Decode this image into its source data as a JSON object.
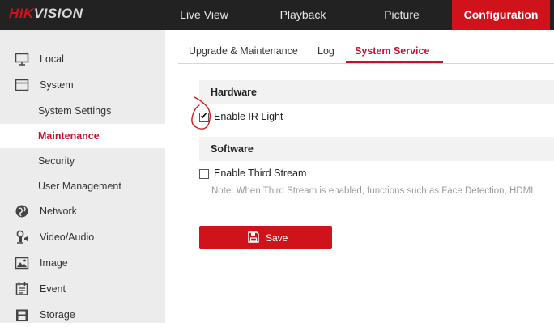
{
  "brand": {
    "logo_prefix": "HIK",
    "logo_suffix": "VISION"
  },
  "topnav": {
    "items": [
      {
        "label": "Live View"
      },
      {
        "label": "Playback"
      },
      {
        "label": "Picture"
      },
      {
        "label": "Configuration",
        "active": true
      }
    ]
  },
  "sidebar": {
    "items": [
      {
        "label": "Local",
        "icon": "monitor-icon"
      },
      {
        "label": "System",
        "icon": "system-icon"
      },
      {
        "label": "System Settings",
        "sub": true
      },
      {
        "label": "Maintenance",
        "sub": true,
        "active": true
      },
      {
        "label": "Security",
        "sub": true
      },
      {
        "label": "User Management",
        "sub": true
      },
      {
        "label": "Network",
        "icon": "globe-icon"
      },
      {
        "label": "Video/Audio",
        "icon": "video-audio-icon"
      },
      {
        "label": "Image",
        "icon": "image-icon"
      },
      {
        "label": "Event",
        "icon": "event-icon"
      },
      {
        "label": "Storage",
        "icon": "storage-icon"
      }
    ]
  },
  "tabs": {
    "items": [
      {
        "label": "Upgrade & Maintenance"
      },
      {
        "label": "Log"
      },
      {
        "label": "System Service",
        "active": true
      }
    ]
  },
  "content": {
    "hardware": {
      "heading": "Hardware",
      "ir_light_label": "Enable IR Light",
      "ir_light_checked": true
    },
    "software": {
      "heading": "Software",
      "third_stream_label": "Enable Third Stream",
      "third_stream_checked": false,
      "note": "Note: When Third Stream is enabled, functions such as Face Detection, HDMI"
    },
    "save_label": "Save"
  },
  "colors": {
    "accent": "#d0121b",
    "topbar": "#222222",
    "sidebar": "#ececec",
    "annotation": "#d11a1a"
  }
}
